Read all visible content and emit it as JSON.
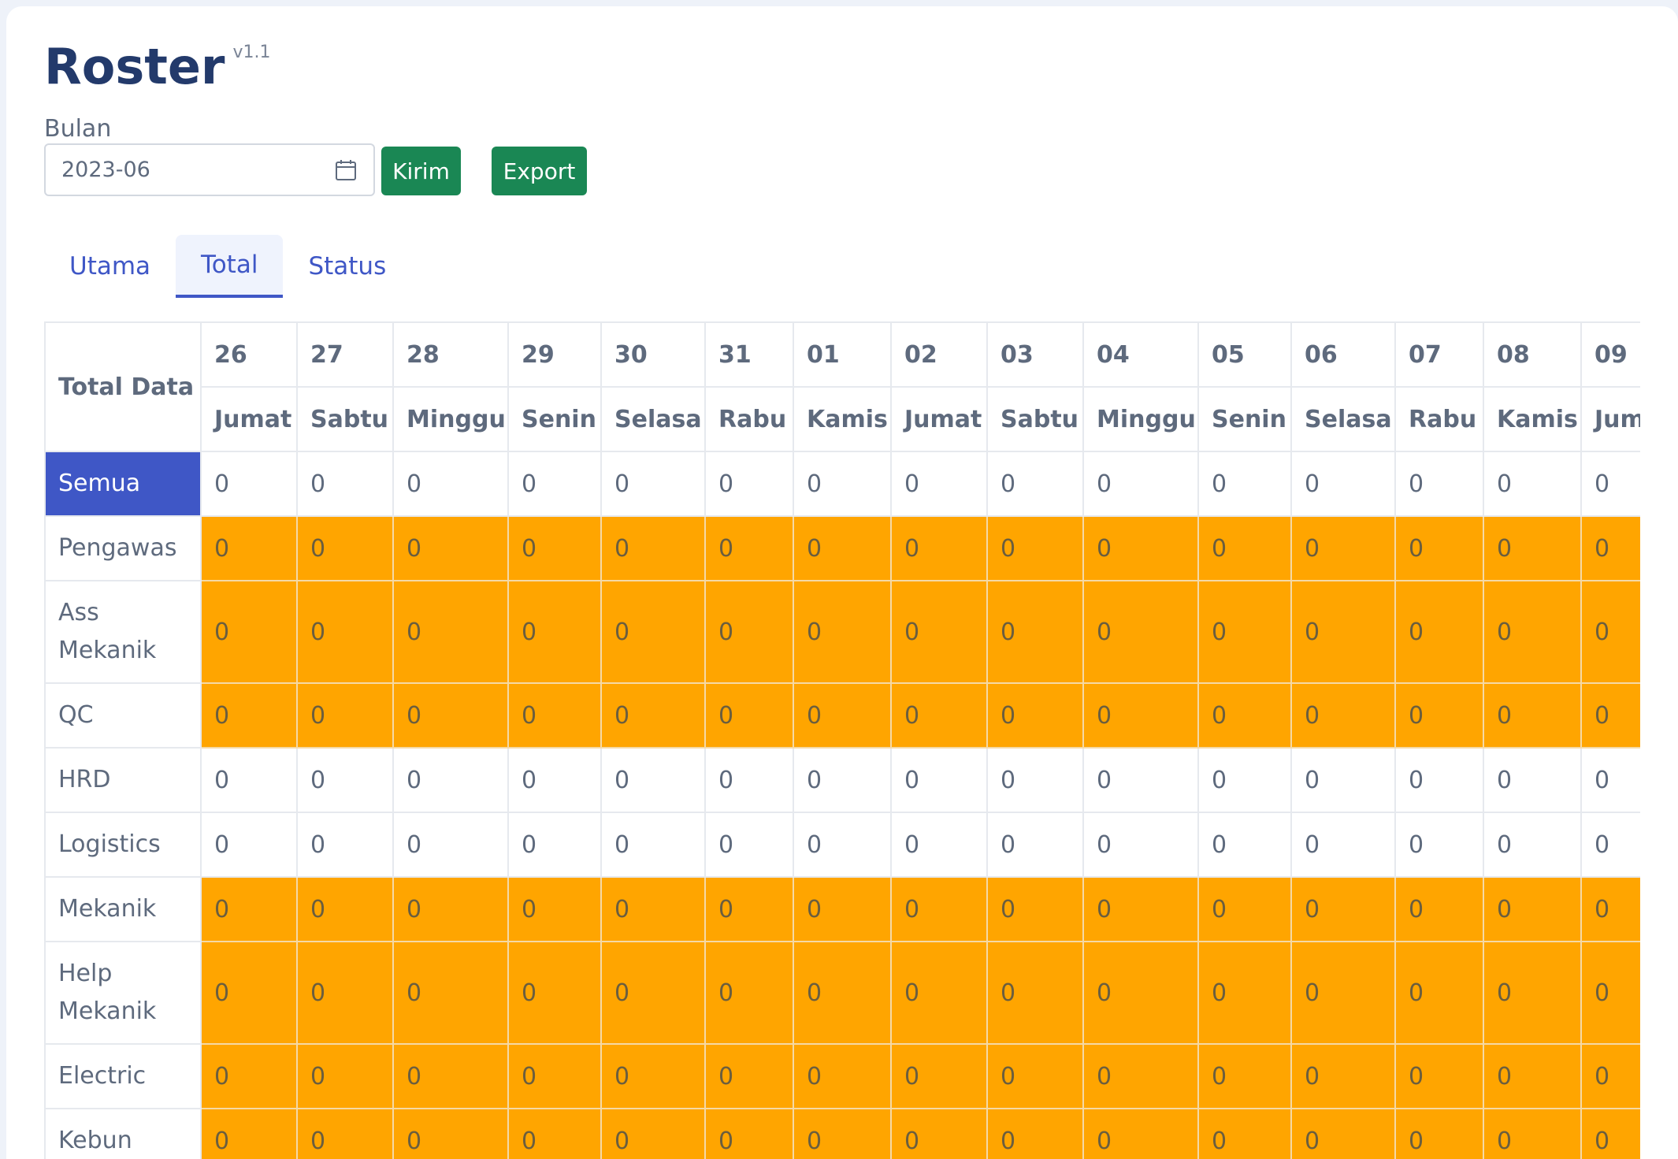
{
  "app": {
    "title": "Roster",
    "version": "v1.1"
  },
  "filter": {
    "label": "Bulan",
    "month_value": "2023-06",
    "submit_label": "Kirim",
    "export_label": "Export",
    "icon": "calendar-icon"
  },
  "tabs": [
    {
      "label": "Utama",
      "active": false
    },
    {
      "label": "Total",
      "active": true
    },
    {
      "label": "Status",
      "active": false
    }
  ],
  "colors": {
    "accent": "#3f57c6",
    "button": "#1a8754",
    "highlight": "#ffa500",
    "title": "#233a6b"
  },
  "table": {
    "corner_label": "Total Data",
    "dates": [
      "26",
      "27",
      "28",
      "29",
      "30",
      "31",
      "01",
      "02",
      "03",
      "04",
      "05",
      "06",
      "07",
      "08",
      "09"
    ],
    "days": [
      "Jumat",
      "Sabtu",
      "Minggu",
      "Senin",
      "Selasa",
      "Rabu",
      "Kamis",
      "Jumat",
      "Sabtu",
      "Minggu",
      "Senin",
      "Selasa",
      "Rabu",
      "Kamis",
      "Jumat"
    ],
    "rows": [
      {
        "label": "Semua",
        "highlight": false,
        "selected": true,
        "values": [
          "0",
          "0",
          "0",
          "0",
          "0",
          "0",
          "0",
          "0",
          "0",
          "0",
          "0",
          "0",
          "0",
          "0",
          "0"
        ]
      },
      {
        "label": "Pengawas",
        "highlight": true,
        "values": [
          "0",
          "0",
          "0",
          "0",
          "0",
          "0",
          "0",
          "0",
          "0",
          "0",
          "0",
          "0",
          "0",
          "0",
          "0"
        ]
      },
      {
        "label": "Ass Mekanik",
        "highlight": true,
        "values": [
          "0",
          "0",
          "0",
          "0",
          "0",
          "0",
          "0",
          "0",
          "0",
          "0",
          "0",
          "0",
          "0",
          "0",
          "0"
        ]
      },
      {
        "label": "QC",
        "highlight": true,
        "values": [
          "0",
          "0",
          "0",
          "0",
          "0",
          "0",
          "0",
          "0",
          "0",
          "0",
          "0",
          "0",
          "0",
          "0",
          "0"
        ]
      },
      {
        "label": "HRD",
        "highlight": false,
        "values": [
          "0",
          "0",
          "0",
          "0",
          "0",
          "0",
          "0",
          "0",
          "0",
          "0",
          "0",
          "0",
          "0",
          "0",
          "0"
        ]
      },
      {
        "label": "Logistics",
        "highlight": false,
        "values": [
          "0",
          "0",
          "0",
          "0",
          "0",
          "0",
          "0",
          "0",
          "0",
          "0",
          "0",
          "0",
          "0",
          "0",
          "0"
        ]
      },
      {
        "label": "Mekanik",
        "highlight": true,
        "values": [
          "0",
          "0",
          "0",
          "0",
          "0",
          "0",
          "0",
          "0",
          "0",
          "0",
          "0",
          "0",
          "0",
          "0",
          "0"
        ]
      },
      {
        "label": "Help Mekanik",
        "highlight": true,
        "values": [
          "0",
          "0",
          "0",
          "0",
          "0",
          "0",
          "0",
          "0",
          "0",
          "0",
          "0",
          "0",
          "0",
          "0",
          "0"
        ]
      },
      {
        "label": "Electric",
        "highlight": true,
        "values": [
          "0",
          "0",
          "0",
          "0",
          "0",
          "0",
          "0",
          "0",
          "0",
          "0",
          "0",
          "0",
          "0",
          "0",
          "0"
        ]
      },
      {
        "label": "Kebun",
        "highlight": true,
        "values": [
          "0",
          "0",
          "0",
          "0",
          "0",
          "0",
          "0",
          "0",
          "0",
          "0",
          "0",
          "0",
          "0",
          "0",
          "0"
        ]
      }
    ]
  }
}
